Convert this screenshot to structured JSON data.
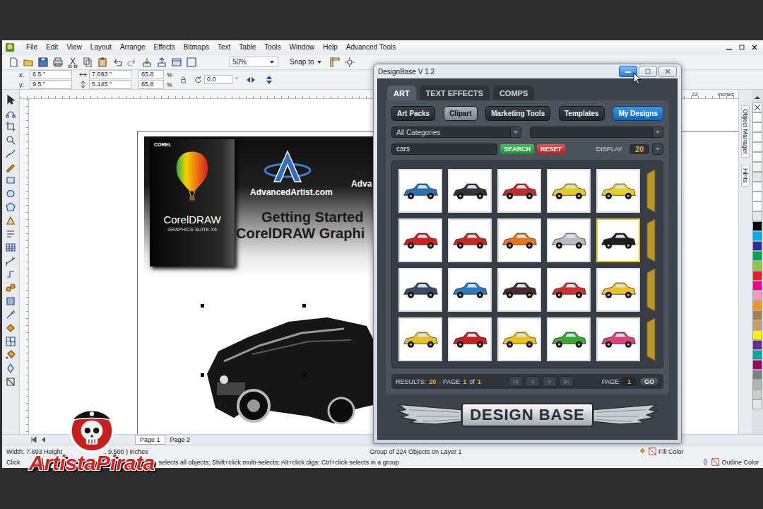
{
  "corel": {
    "menu": [
      "File",
      "Edit",
      "View",
      "Layout",
      "Arrange",
      "Effects",
      "Bitmaps",
      "Text",
      "Table",
      "Tools",
      "Window",
      "Help",
      "Advanced Tools"
    ],
    "toolbar": {
      "zoom": "50%",
      "snap": "Snap to"
    },
    "properties": {
      "position": [
        {
          "label": "x:",
          "value": "6.5 \""
        },
        {
          "label": "y:",
          "value": "9.5 \""
        }
      ],
      "size": [
        "7.693 \"",
        "5.145 \""
      ],
      "scale": [
        "65.8",
        "65.8"
      ],
      "scale_unit": "%",
      "rotation": "0.0",
      "rotation_unit": "°"
    },
    "ruler": {
      "marks": [
        "22"
      ],
      "unit": "inches"
    },
    "document": {
      "banner": {
        "box": {
          "brand": "COREL",
          "product": "CorelDRAW",
          "edition": "GRAPHICS SUITE X6"
        },
        "site": "AdvancedArtist.com",
        "side_text": "Adva",
        "headline": [
          "Getting Started",
          "CorelDRAW Graphi"
        ]
      },
      "selected": true
    },
    "dockers": [
      "Object Manager",
      "Hints"
    ],
    "palette": [
      {
        "color": "#ffffff"
      },
      {
        "color": "#ffffff"
      },
      {
        "color": "#ffffff"
      },
      {
        "color": "#ffffff"
      },
      {
        "color": "#ffffff"
      },
      {
        "color": "#f2f2f2"
      },
      {
        "color": "#e5e5e5"
      },
      {
        "color": "#ffffff"
      },
      {
        "color": "#ffffff"
      },
      {
        "color": "#ffffff"
      },
      {
        "color": "#e6e6e6"
      },
      {
        "color": "#000000"
      },
      {
        "color": "#00aeef"
      },
      {
        "color": "#2e3192"
      },
      {
        "color": "#00a651"
      },
      {
        "color": "#8dc63f"
      },
      {
        "color": "#ed1c24"
      },
      {
        "color": "#ec008c"
      },
      {
        "color": "#f49ac1"
      },
      {
        "color": "#f7941d"
      },
      {
        "color": "#a67c52"
      },
      {
        "color": "#c69c6d"
      },
      {
        "color": "#fff200"
      },
      {
        "color": "#662d91"
      },
      {
        "color": "#00a99d"
      },
      {
        "color": "#9e005d"
      },
      {
        "color": "#808080"
      },
      {
        "color": "#b3b3b3"
      },
      {
        "color": "#cccccc"
      },
      {
        "color": "#e6e6e6"
      }
    ],
    "pages": [
      {
        "label": "Page 1",
        "selected": true
      },
      {
        "label": "Page 2",
        "selected": false
      }
    ],
    "status_bar": {
      "size": "Width: 7.693 Height",
      "position": ", 9.500 ) inches",
      "object": "Group of 224 Objects on Layer 1",
      "fill": "Fill Color",
      "outline": "Outline Color",
      "hint_start": "Click",
      "hint": "selects all objects; Shift+click multi-selects; Alt+click digs; Ctrl+click selects in a group"
    }
  },
  "designbase": {
    "title": "DesignBase V 1.2",
    "tabs": [
      {
        "label": "ART",
        "selected": true
      },
      {
        "label": "TEXT EFFECTS",
        "selected": false
      },
      {
        "label": "COMPS",
        "selected": false
      }
    ],
    "sections": [
      {
        "label": "Art Packs",
        "selected": false,
        "kind": "normal"
      },
      {
        "label": "Clipart",
        "selected": true,
        "kind": "normal"
      },
      {
        "label": "Marketing Tools",
        "selected": false,
        "kind": "normal"
      },
      {
        "label": "Templates",
        "selected": false,
        "kind": "normal"
      },
      {
        "label": "My Designs",
        "selected": false,
        "kind": "accent"
      }
    ],
    "category": "All Categories",
    "subcategory": "",
    "search": {
      "value": "cars",
      "search_button": "SEARCH",
      "reset_button": "RESET",
      "display_label": "DISPLAY",
      "display_value": "20"
    },
    "thumbnails": [
      {
        "color": "#2b6fb5",
        "selected": false
      },
      {
        "color": "#333333",
        "selected": false
      },
      {
        "color": "#c42a2a",
        "selected": false
      },
      {
        "color": "#e8c81a",
        "selected": false
      },
      {
        "color": "#e8d020",
        "selected": false
      },
      {
        "color": "#d21f1f",
        "selected": false
      },
      {
        "color": "#c8281e",
        "selected": false
      },
      {
        "color": "#e8761c",
        "selected": false
      },
      {
        "color": "#b8bcc0",
        "selected": false
      },
      {
        "color": "#1e1e1e",
        "selected": true
      },
      {
        "color": "#3a4a66",
        "selected": false
      },
      {
        "color": "#2a7ac0",
        "selected": false
      },
      {
        "color": "#4a2a2a",
        "selected": false
      },
      {
        "color": "#d03030",
        "selected": false
      },
      {
        "color": "#f0c020",
        "selected": false
      },
      {
        "color": "#e8c020",
        "selected": false
      },
      {
        "color": "#c8201c",
        "selected": false
      },
      {
        "color": "#f0c010",
        "selected": false
      },
      {
        "color": "#3aa830",
        "selected": false
      },
      {
        "color": "#e0407a",
        "selected": false
      }
    ],
    "results": {
      "label": "RESULTS:",
      "count": "20",
      "page_label": "- PAGE",
      "page": "1",
      "of_label": "of",
      "pages": "1",
      "goto_label": "PAGE",
      "goto_value": "1",
      "go_button": "GO"
    },
    "logo": "DESIGN BASE"
  },
  "watermark": {
    "text": "ArtistaPirata"
  }
}
